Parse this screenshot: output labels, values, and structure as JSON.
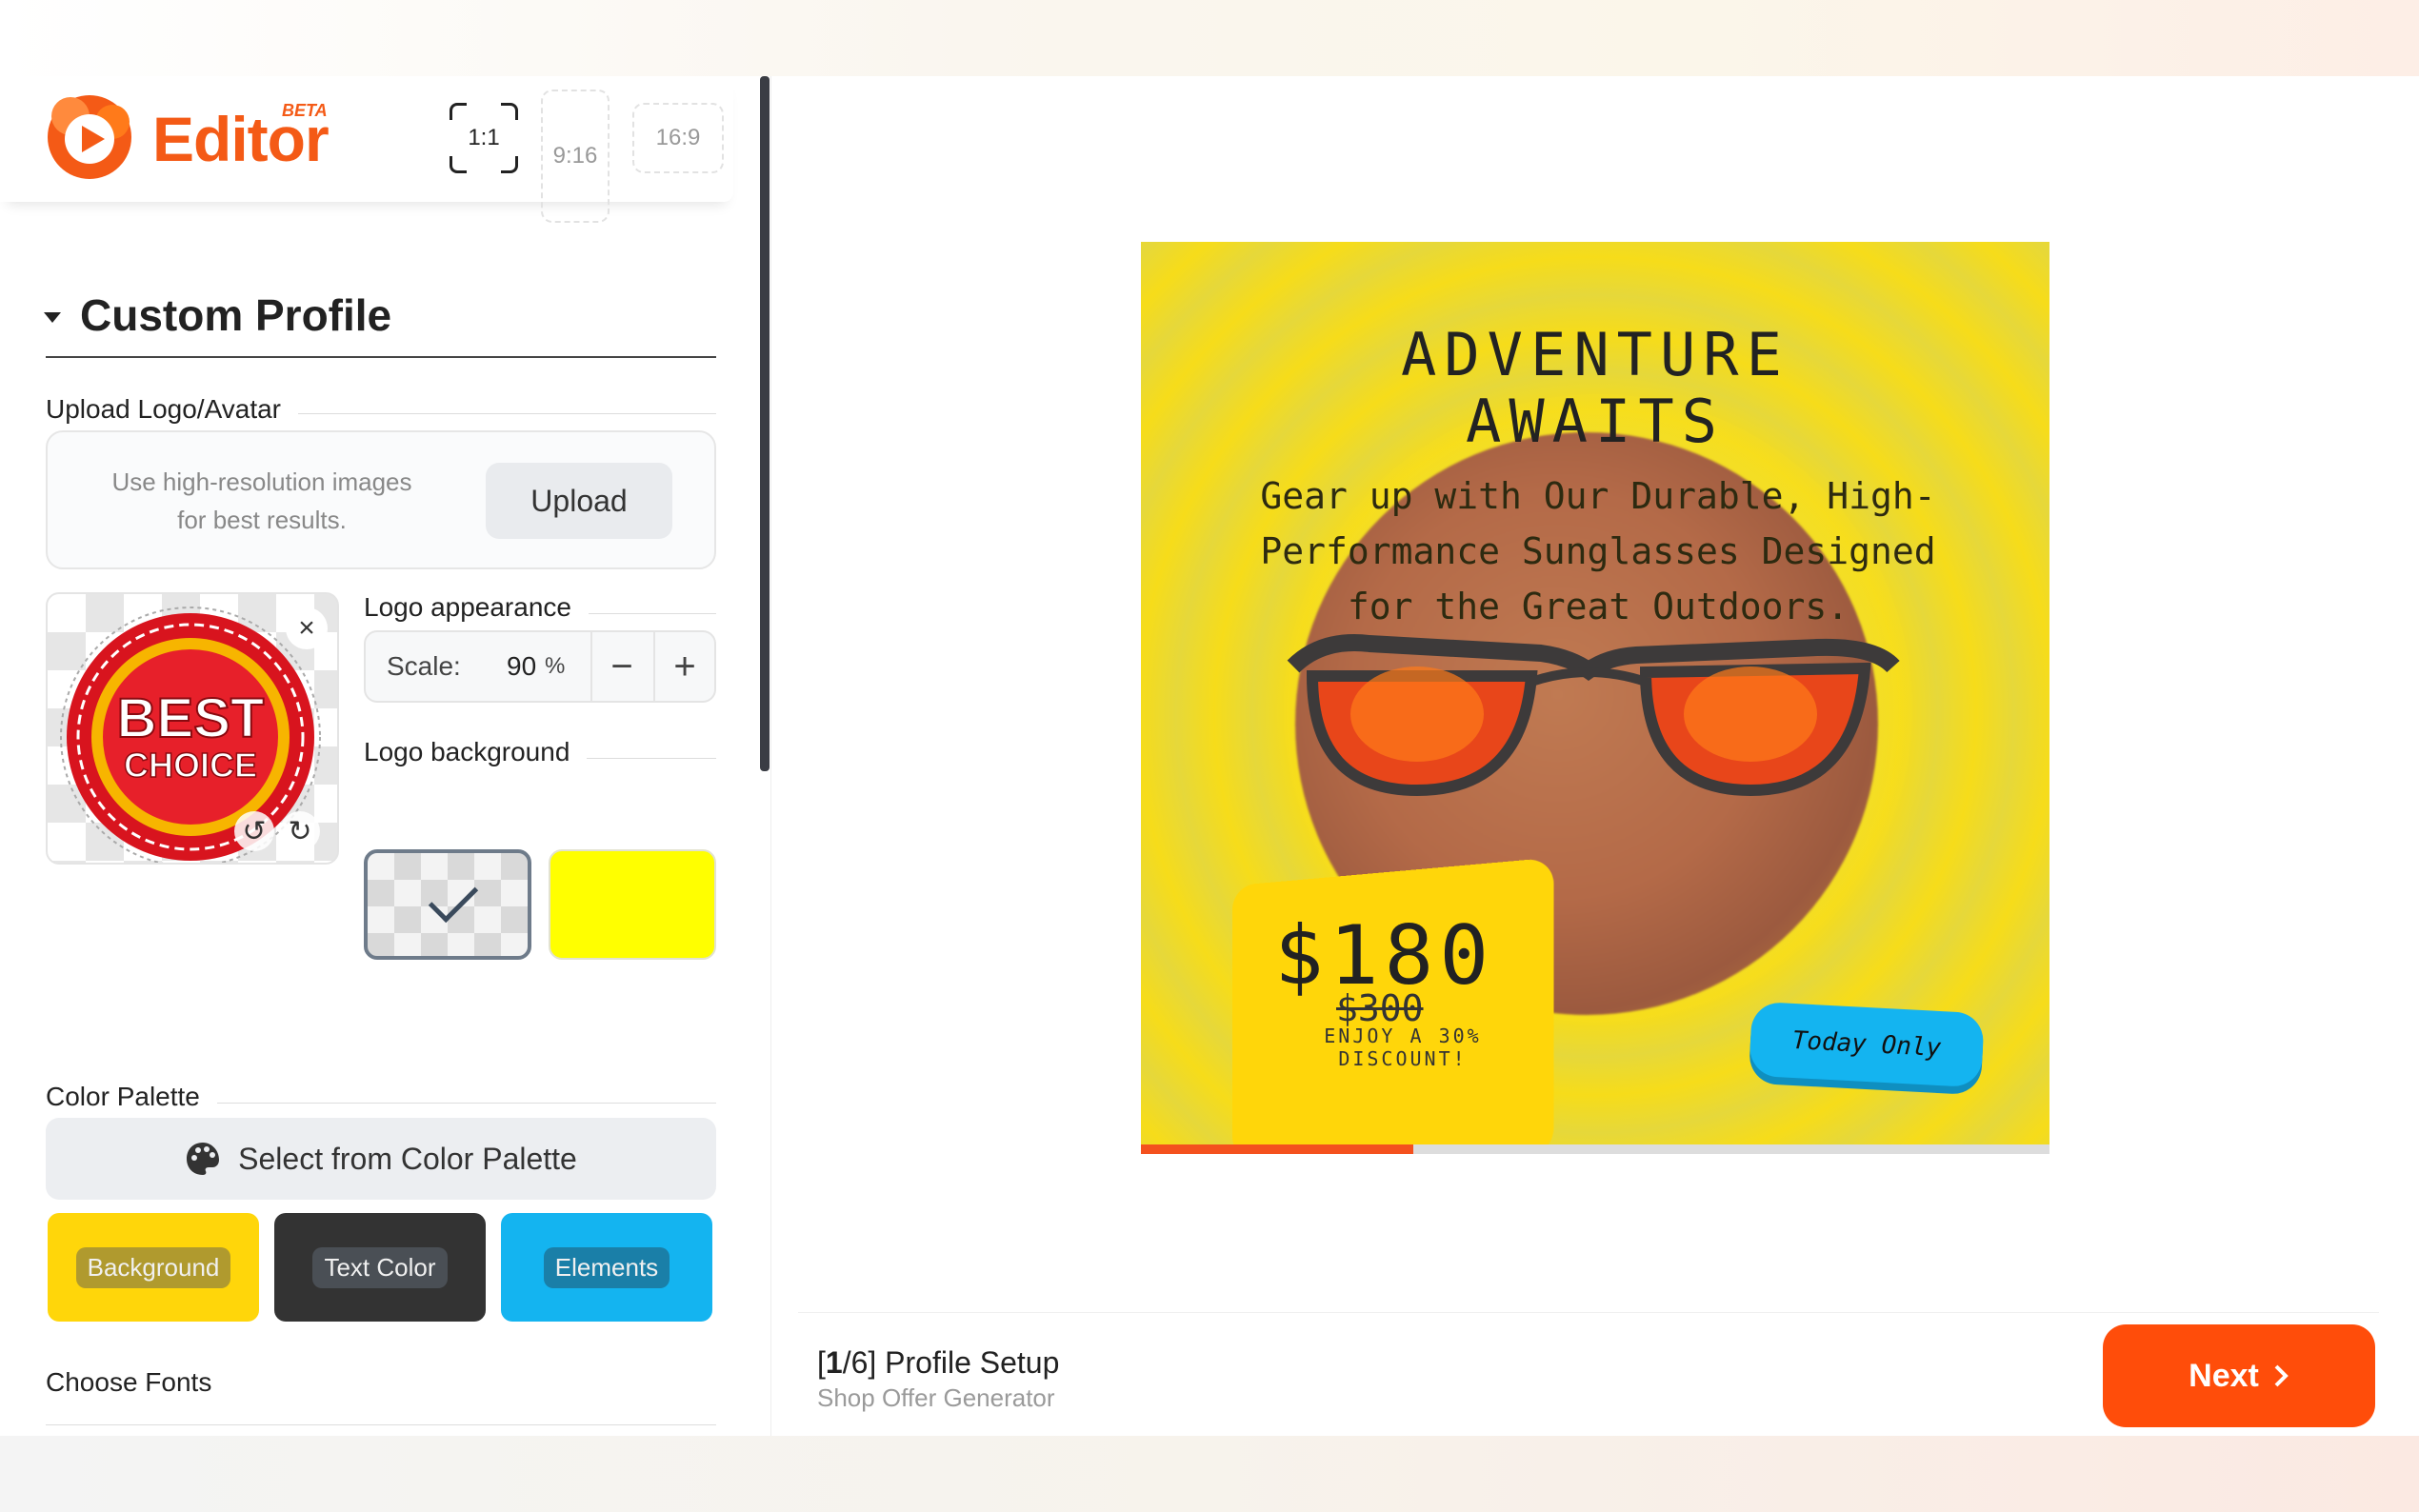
{
  "app": {
    "name": "Editor",
    "badge": "BETA"
  },
  "ratios": [
    {
      "label": "1:1",
      "active": true
    },
    {
      "label": "9:16",
      "active": false
    },
    {
      "label": "16:9",
      "active": false
    }
  ],
  "section": {
    "title": "Custom Profile"
  },
  "upload": {
    "label": "Upload Logo/Avatar",
    "hint": "Use high-resolution images for best results.",
    "button": "Upload"
  },
  "logo": {
    "image_text_line1": "BEST",
    "image_text_line2": "CHOICE",
    "appearance_label": "Logo appearance",
    "scale_label": "Scale:",
    "scale_value": "90",
    "scale_unit": "%",
    "decrement": "−",
    "increment": "+",
    "background_label": "Logo background",
    "background_options": [
      "transparent",
      "#ffff00"
    ],
    "selected_background": "transparent"
  },
  "palette": {
    "label": "Color Palette",
    "button": "Select from Color Palette",
    "swatches": [
      {
        "label": "Background",
        "color": "#ffd60a"
      },
      {
        "label": "Text Color",
        "color": "#333333"
      },
      {
        "label": "Elements",
        "color": "#14b4f0"
      }
    ]
  },
  "fonts": {
    "label": "Choose Fonts"
  },
  "preview": {
    "headline": "ADVENTURE AWAITS",
    "subline": "Gear up with Our Durable, High-Performance Sunglasses Designed for the Great Outdoors.",
    "price": "$180",
    "old_price": "$300",
    "discount_note": "ENJOY A 30% DISCOUNT!",
    "badge": "Today Only",
    "progress": 0.3
  },
  "footer": {
    "step_current": "1",
    "step_total": "6",
    "step_name": "Profile Setup",
    "subtitle": "Shop Offer Generator",
    "next": "Next"
  },
  "colors": {
    "accent": "#ff4d0a",
    "brand": "#f45a16"
  }
}
